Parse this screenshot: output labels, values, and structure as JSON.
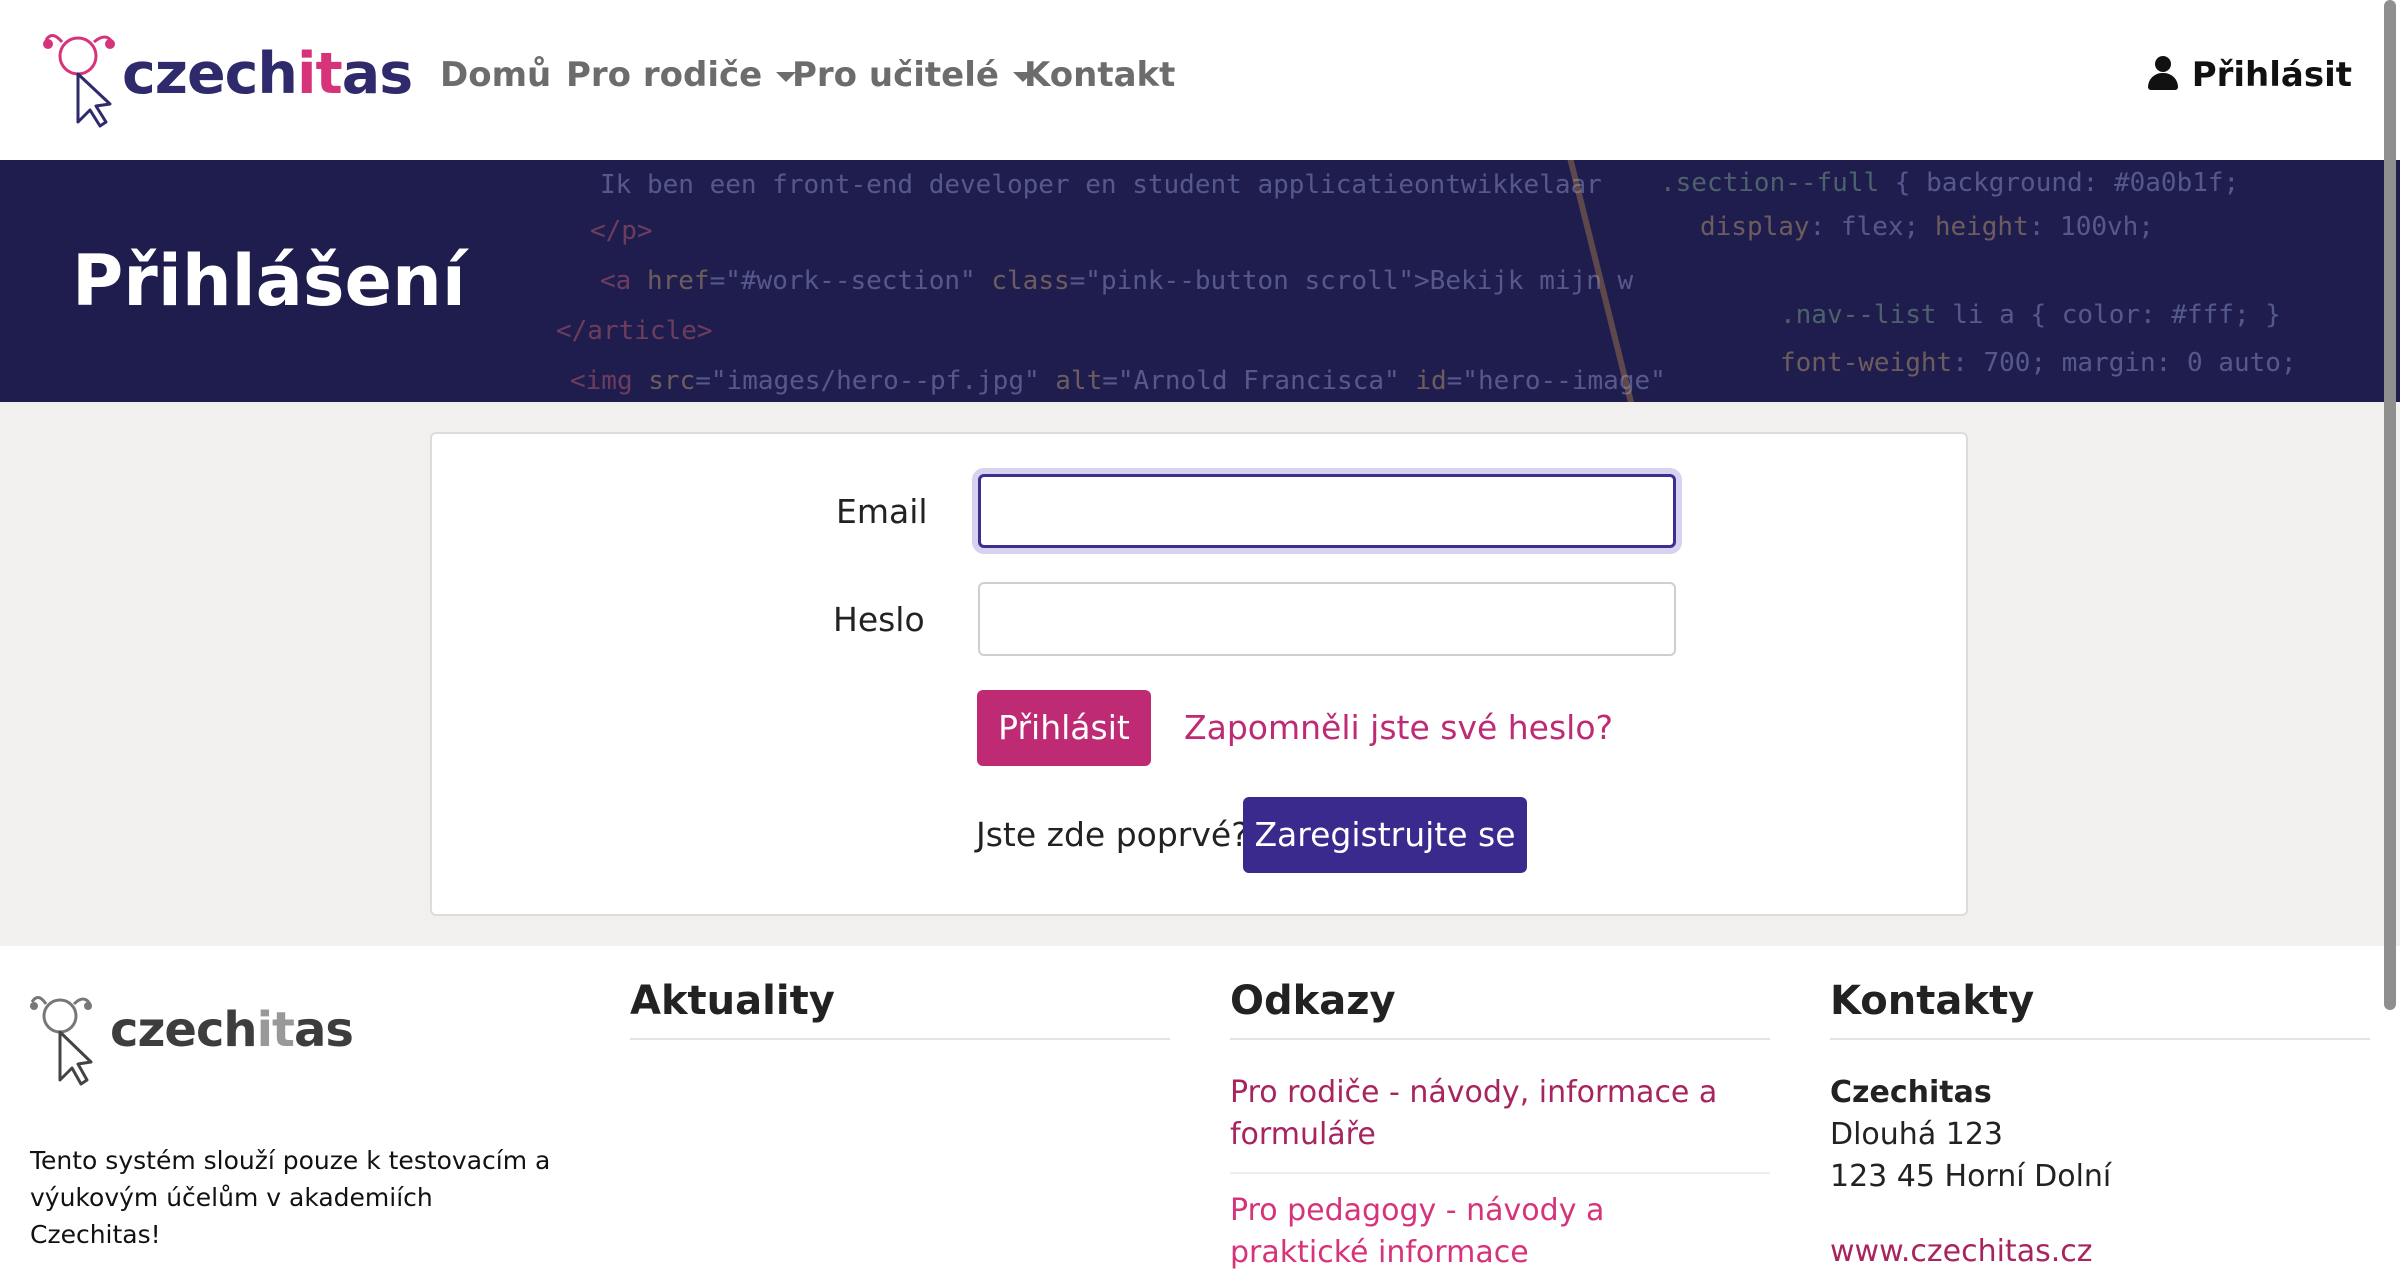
{
  "brand": {
    "logo_a": "czech",
    "logo_b": "it",
    "logo_c": "as"
  },
  "nav": {
    "home": "Domů",
    "parents": "Pro rodiče",
    "teachers": "Pro učitelé",
    "contact": "Kontakt",
    "login": "Přihlásit"
  },
  "hero": {
    "title": "Přihlášení"
  },
  "form": {
    "email_label": "Email",
    "email_value": "",
    "password_label": "Heslo",
    "password_value": "",
    "login_button": "Přihlásit",
    "forgot_link": "Zapomněli jste své heslo?",
    "first_time": "Jste zde poprvé?",
    "register_button": "Zaregistrujte se"
  },
  "footer": {
    "logo_a": "czech",
    "logo_b": "it",
    "logo_c": "as",
    "note": "Tento systém slouží pouze k testovacím a výukovým účelům v akademiích Czechitas!",
    "news_heading": "Aktuality",
    "links_heading": "Odkazy",
    "links": [
      "Pro rodiče - návody, informace a formuláře",
      "Pro pedagogy - návody a praktické informace"
    ],
    "contacts_heading": "Kontakty",
    "contact_name": "Czechitas",
    "contact_street": "Dlouhá 123",
    "contact_city": "123 45 Horní Dolní",
    "contact_web": "www.czechitas.cz"
  },
  "colors": {
    "primary": "#be2a73",
    "secondary": "#3a2a8e",
    "hero_bg": "#1f1d4e",
    "brand_navy": "#2e2a6b",
    "brand_pink": "#d6337a"
  }
}
